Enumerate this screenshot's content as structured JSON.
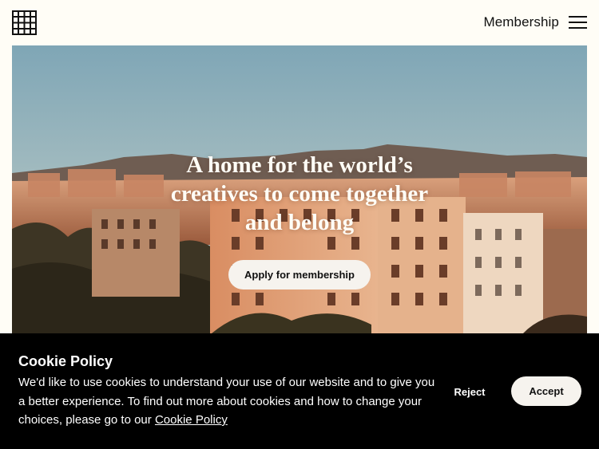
{
  "header": {
    "nav_label": "Membership",
    "logo_icon": "grid-logo-icon",
    "menu_icon": "hamburger-menu-icon"
  },
  "hero": {
    "title_lines": [
      "A home for the world’s",
      "creatives to come together",
      "and belong"
    ],
    "cta_label": "Apply for membership",
    "image": "city-skyline-photo"
  },
  "cookie_banner": {
    "title": "Cookie Policy",
    "body": "We'd like to use cookies to understand your use of our website and to give you a better experience. To find out more about cookies and how to change your choices, please go to our ",
    "link_label": "Cookie Policy",
    "reject_label": "Reject",
    "accept_label": "Accept"
  },
  "colors": {
    "page_bg": "#fffdf6",
    "banner_bg": "#000000",
    "button_bg": "#f6f3ee"
  }
}
